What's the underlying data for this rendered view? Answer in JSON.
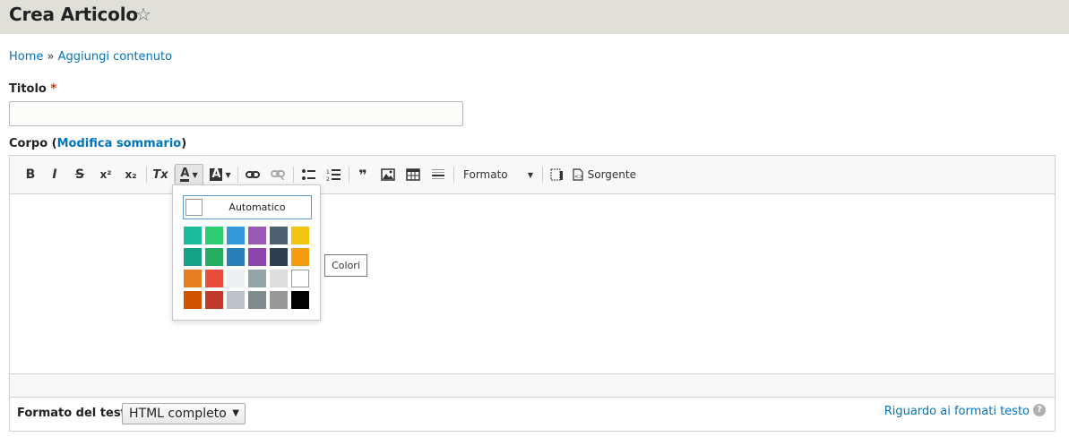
{
  "header": {
    "title": "Crea Articolo",
    "favorite_icon": "star-outline-icon"
  },
  "breadcrumb": {
    "home": "Home",
    "separator": "»",
    "current": "Aggiungi contenuto"
  },
  "title_field": {
    "label": "Titolo",
    "required_mark": "*",
    "value": ""
  },
  "body_field": {
    "label": "Corpo",
    "open_paren": "(",
    "summary_link": "Modifica sommario",
    "close_paren": ")"
  },
  "toolbar": {
    "bold": "B",
    "italic": "I",
    "strike": "S",
    "superscript": "x²",
    "subscript": "x₂",
    "remove_format": "Tx",
    "text_color": "A",
    "bg_color": "A",
    "format_dropdown": "Formato",
    "source_label": "Sorgente"
  },
  "color_panel": {
    "automatic_label": "Automatico",
    "colors": [
      [
        "#1abc9c",
        "#2ecc71",
        "#3498db",
        "#9b59b6",
        "#4e5f70",
        "#f1c40f"
      ],
      [
        "#16a085",
        "#27ae60",
        "#2980b9",
        "#8e44ad",
        "#2c3e50",
        "#f39c12"
      ],
      [
        "#e67e22",
        "#e74c3c",
        "#ecf0f1",
        "#95a5a6",
        "#dddddd",
        "#ffffff"
      ],
      [
        "#d35400",
        "#c0392b",
        "#bdc3c7",
        "#7f8c8d",
        "#999999",
        "#000000"
      ]
    ]
  },
  "tooltip": {
    "text": "Colori"
  },
  "text_format": {
    "label": "Formato del testo",
    "selected": "HTML completo",
    "help_link": "Riguardo ai formati testo",
    "help_icon": "?"
  }
}
